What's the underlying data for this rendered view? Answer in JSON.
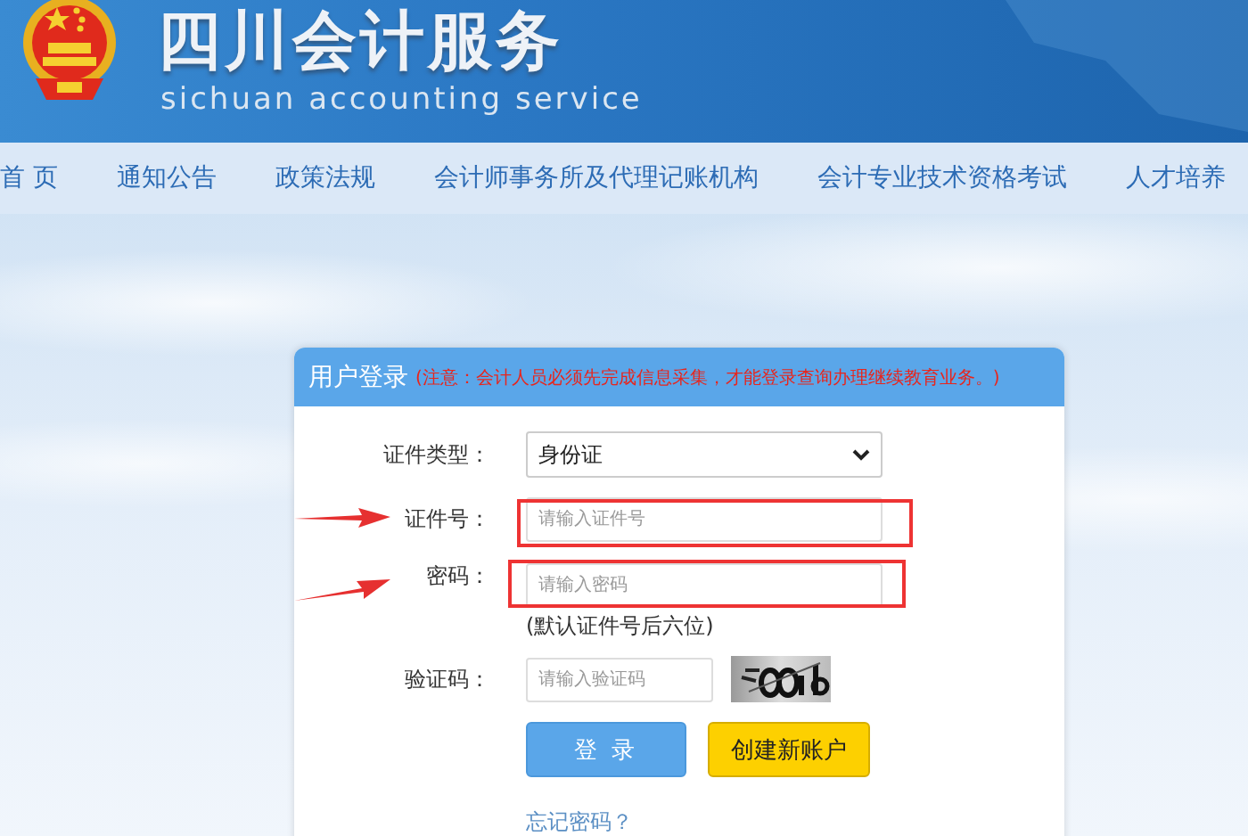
{
  "header": {
    "title": "四川会计服务",
    "subtitle": "sichuan accounting service"
  },
  "nav": [
    {
      "label": "首 页"
    },
    {
      "label": "通知公告"
    },
    {
      "label": "政策法规"
    },
    {
      "label": "会计师事务所及代理记账机构"
    },
    {
      "label": "会计专业技术资格考试"
    },
    {
      "label": "人才培养"
    }
  ],
  "login": {
    "title": "用户登录",
    "notice": "(注意：会计人员必须先完成信息采集，才能登录查询办理继续教育业务。)",
    "fields": [
      {
        "kind": "select",
        "label": "证件类型：",
        "value": "身份证",
        "annotated": false
      },
      {
        "kind": "text",
        "label": "证件号：",
        "placeholder": "请输入证件号",
        "annotated": true
      },
      {
        "kind": "password",
        "label": "密码：",
        "placeholder": "请输入密码",
        "annotated": true,
        "hint": "(默认证件号后六位)"
      },
      {
        "kind": "captcha",
        "label": "验证码：",
        "placeholder": "请输入验证码",
        "annotated": false
      }
    ],
    "buttons": [
      {
        "kind": "primary",
        "label": "登 录"
      },
      {
        "kind": "secondary",
        "label": "创建新账户"
      }
    ],
    "forgot_link": "忘记密码？"
  }
}
